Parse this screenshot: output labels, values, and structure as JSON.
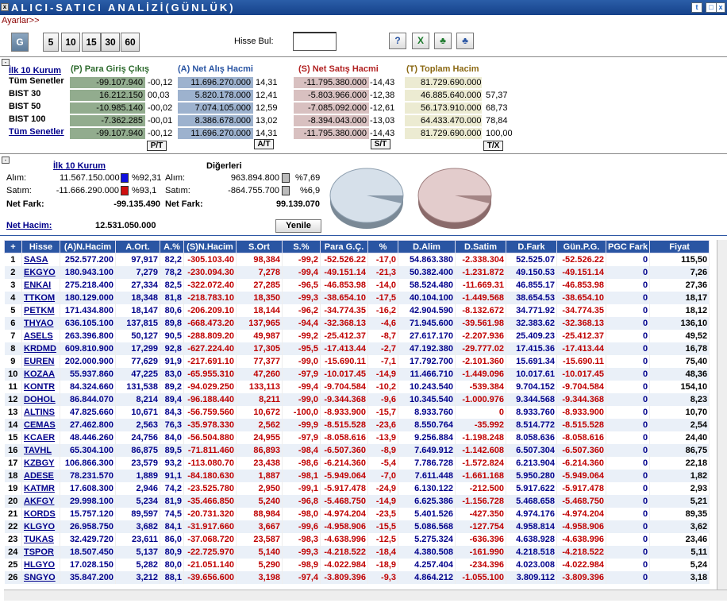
{
  "title": "ALICI-SATICI ANALİZİ(GÜNLÜK)",
  "ayarlar": "Ayarlar>>",
  "periods": [
    "G",
    "5",
    "10",
    "15",
    "30",
    "60"
  ],
  "hisse_bul_label": "Hisse Bul:",
  "top": {
    "ilk10": "İlk 10 Kurum",
    "h_p": "(P) Para Giriş Çıkış",
    "h_a": "(A) Net Alış Hacmi",
    "h_s": "(S) Net Satış Hacmi",
    "h_t": "(T) Toplam Hacim",
    "rows": [
      {
        "name": "Tüm Senetler",
        "p": "-99.107.940",
        "pp": "-00,12",
        "a": "11.696.270.000",
        "ap": "14,31",
        "s": "-11.795.380.000",
        "sp": "-14,43",
        "t": "81.729.690.000",
        "tp": ""
      },
      {
        "name": "BIST 30",
        "p": "16.212.150",
        "pp": "00,03",
        "a": "5.820.178.000",
        "ap": "12,41",
        "s": "-5.803.966.000",
        "sp": "-12,38",
        "t": "46.885.640.000",
        "tp": "57,37"
      },
      {
        "name": "BIST 50",
        "p": "-10.985.140",
        "pp": "-00,02",
        "a": "7.074.105.000",
        "ap": "12,59",
        "s": "-7.085.092.000",
        "sp": "-12,61",
        "t": "56.173.910.000",
        "tp": "68,73"
      },
      {
        "name": "BIST 100",
        "p": "-7.362.285",
        "pp": "-00,01",
        "a": "8.386.678.000",
        "ap": "13,02",
        "s": "-8.394.043.000",
        "sp": "-13,03",
        "t": "64.433.470.000",
        "tp": "78,84"
      },
      {
        "name": "Tüm Senetler",
        "p": "-99.107.940",
        "pp": "-00,12",
        "a": "11.696.270.000",
        "ap": "14,31",
        "s": "-11.795.380.000",
        "sp": "-14,43",
        "t": "81.729.690.000",
        "tp": "100,00"
      }
    ],
    "btn_p": "P/T",
    "btn_a": "A/T",
    "btn_s": "S/T",
    "btn_t": "T/X"
  },
  "mid": {
    "ilk10": "İlk 10 Kurum",
    "digerleri": "Diğerleri",
    "alim_lbl": "Alım:",
    "satim_lbl": "Satım:",
    "netfark_lbl": "Net Fark:",
    "alim": "11.567.150.000",
    "alim_p": "%92,31",
    "satim": "-11.666.290.000",
    "satim_p": "%93,1",
    "netfark": "-99.135.490",
    "d_alim": "963.894.800",
    "d_alim_p": "%7,69",
    "d_satim": "-864.755.700",
    "d_satim_p": "%6,9",
    "d_netfark": "99.139.070",
    "nethacim_lbl": "Net Hacim:",
    "nethacim": "12.531.050.000",
    "yenile": "Yenile"
  },
  "columns": [
    "+",
    "Hisse",
    "(A)N.Hacim",
    "A.Ort.",
    "A.%",
    "(S)N.Hacim",
    "S.Ort",
    "S.%",
    "Para G.Ç.",
    "%",
    "D.Alim",
    "D.Satim",
    "D.Fark",
    "Gün.P.G.",
    "PGC Fark",
    "Fiyat"
  ],
  "rows": [
    [
      "1",
      "SASA",
      "252.577.200",
      "97,917",
      "82,2",
      "-305.103.40",
      "98,384",
      "-99,2",
      "-52.526.22",
      "-17,0",
      "54.863.380",
      "-2.338.304",
      "52.525.07",
      "-52.526.22",
      "0",
      "115,50"
    ],
    [
      "2",
      "EKGYO",
      "180.943.100",
      "7,279",
      "78,2",
      "-230.094.30",
      "7,278",
      "-99,4",
      "-49.151.14",
      "-21,3",
      "50.382.400",
      "-1.231.872",
      "49.150.53",
      "-49.151.14",
      "0",
      "7,26"
    ],
    [
      "3",
      "ENKAI",
      "275.218.400",
      "27,334",
      "82,5",
      "-322.072.40",
      "27,285",
      "-96,5",
      "-46.853.98",
      "-14,0",
      "58.524.480",
      "-11.669.31",
      "46.855.17",
      "-46.853.98",
      "0",
      "27,36"
    ],
    [
      "4",
      "TTKOM",
      "180.129.000",
      "18,348",
      "81,8",
      "-218.783.10",
      "18,350",
      "-99,3",
      "-38.654.10",
      "-17,5",
      "40.104.100",
      "-1.449.568",
      "38.654.53",
      "-38.654.10",
      "0",
      "18,17"
    ],
    [
      "5",
      "PETKM",
      "171.434.800",
      "18,147",
      "80,6",
      "-206.209.10",
      "18,144",
      "-96,2",
      "-34.774.35",
      "-16,2",
      "42.904.590",
      "-8.132.672",
      "34.771.92",
      "-34.774.35",
      "0",
      "18,12"
    ],
    [
      "6",
      "THYAO",
      "636.105.100",
      "137,815",
      "89,8",
      "-668.473.20",
      "137,965",
      "-94,4",
      "-32.368.13",
      "-4,6",
      "71.945.600",
      "-39.561.98",
      "32.383.62",
      "-32.368.13",
      "0",
      "136,10"
    ],
    [
      "7",
      "ASELS",
      "263.396.800",
      "50,127",
      "90,5",
      "-288.809.20",
      "49,987",
      "-99,2",
      "-25.412.37",
      "-8,7",
      "27.617.170",
      "-2.207.936",
      "25.409.23",
      "-25.412.37",
      "0",
      "49,52"
    ],
    [
      "8",
      "KRDMD",
      "609.810.900",
      "17,299",
      "92,8",
      "-627.224.40",
      "17,305",
      "-95,5",
      "-17.413.44",
      "-2,7",
      "47.192.380",
      "-29.777.02",
      "17.415.36",
      "-17.413.44",
      "0",
      "16,78"
    ],
    [
      "9",
      "EUREN",
      "202.000.900",
      "77,629",
      "91,9",
      "-217.691.10",
      "77,377",
      "-99,0",
      "-15.690.11",
      "-7,1",
      "17.792.700",
      "-2.101.360",
      "15.691.34",
      "-15.690.11",
      "0",
      "75,40"
    ],
    [
      "10",
      "KOZAA",
      "55.937.860",
      "47,225",
      "83,0",
      "-65.955.310",
      "47,260",
      "-97,9",
      "-10.017.45",
      "-14,9",
      "11.466.710",
      "-1.449.096",
      "10.017.61",
      "-10.017.45",
      "0",
      "48,36"
    ],
    [
      "11",
      "KONTR",
      "84.324.660",
      "131,538",
      "89,2",
      "-94.029.250",
      "133,113",
      "-99,4",
      "-9.704.584",
      "-10,2",
      "10.243.540",
      "-539.384",
      "9.704.152",
      "-9.704.584",
      "0",
      "154,10"
    ],
    [
      "12",
      "DOHOL",
      "86.844.070",
      "8,214",
      "89,4",
      "-96.188.440",
      "8,211",
      "-99,0",
      "-9.344.368",
      "-9,6",
      "10.345.540",
      "-1.000.976",
      "9.344.568",
      "-9.344.368",
      "0",
      "8,23"
    ],
    [
      "13",
      "ALTINS",
      "47.825.660",
      "10,671",
      "84,3",
      "-56.759.560",
      "10,672",
      "-100,0",
      "-8.933.900",
      "-15,7",
      "8.933.760",
      "0",
      "8.933.760",
      "-8.933.900",
      "0",
      "10,70"
    ],
    [
      "14",
      "CEMAS",
      "27.462.800",
      "2,563",
      "76,3",
      "-35.978.330",
      "2,562",
      "-99,9",
      "-8.515.528",
      "-23,6",
      "8.550.764",
      "-35.992",
      "8.514.772",
      "-8.515.528",
      "0",
      "2,54"
    ],
    [
      "15",
      "KCAER",
      "48.446.260",
      "24,756",
      "84,0",
      "-56.504.880",
      "24,955",
      "-97,9",
      "-8.058.616",
      "-13,9",
      "9.256.884",
      "-1.198.248",
      "8.058.636",
      "-8.058.616",
      "0",
      "24,40"
    ],
    [
      "16",
      "TAVHL",
      "65.304.100",
      "86,875",
      "89,5",
      "-71.811.460",
      "86,893",
      "-98,4",
      "-6.507.360",
      "-8,9",
      "7.649.912",
      "-1.142.608",
      "6.507.304",
      "-6.507.360",
      "0",
      "86,75"
    ],
    [
      "17",
      "KZBGY",
      "106.866.300",
      "23,579",
      "93,2",
      "-113.080.70",
      "23,438",
      "-98,6",
      "-6.214.360",
      "-5,4",
      "7.786.728",
      "-1.572.824",
      "6.213.904",
      "-6.214.360",
      "0",
      "22,18"
    ],
    [
      "18",
      "ADESE",
      "78.231.570",
      "1,889",
      "91,1",
      "-84.180.630",
      "1,887",
      "-98,1",
      "-5.949.064",
      "-7,0",
      "7.611.448",
      "-1.661.168",
      "5.950.280",
      "-5.949.064",
      "0",
      "1,82"
    ],
    [
      "19",
      "KATMR",
      "17.608.300",
      "2,946",
      "74,2",
      "-23.525.780",
      "2,950",
      "-99,1",
      "-5.917.478",
      "-24,9",
      "6.130.122",
      "-212.500",
      "5.917.622",
      "-5.917.478",
      "0",
      "2,93"
    ],
    [
      "20",
      "AKFGY",
      "29.998.100",
      "5,234",
      "81,9",
      "-35.466.850",
      "5,240",
      "-96,8",
      "-5.468.750",
      "-14,9",
      "6.625.386",
      "-1.156.728",
      "5.468.658",
      "-5.468.750",
      "0",
      "5,21"
    ],
    [
      "21",
      "KORDS",
      "15.757.120",
      "89,597",
      "74,5",
      "-20.731.320",
      "88,984",
      "-98,0",
      "-4.974.204",
      "-23,5",
      "5.401.526",
      "-427.350",
      "4.974.176",
      "-4.974.204",
      "0",
      "89,35"
    ],
    [
      "22",
      "KLGYO",
      "26.958.750",
      "3,682",
      "84,1",
      "-31.917.660",
      "3,667",
      "-99,6",
      "-4.958.906",
      "-15,5",
      "5.086.568",
      "-127.754",
      "4.958.814",
      "-4.958.906",
      "0",
      "3,62"
    ],
    [
      "23",
      "TUKAS",
      "32.429.720",
      "23,611",
      "86,0",
      "-37.068.720",
      "23,587",
      "-98,3",
      "-4.638.996",
      "-12,5",
      "5.275.324",
      "-636.396",
      "4.638.928",
      "-4.638.996",
      "0",
      "23,46"
    ],
    [
      "24",
      "TSPOR",
      "18.507.450",
      "5,137",
      "80,9",
      "-22.725.970",
      "5,140",
      "-99,3",
      "-4.218.522",
      "-18,4",
      "4.380.508",
      "-161.990",
      "4.218.518",
      "-4.218.522",
      "0",
      "5,11"
    ],
    [
      "25",
      "HLGYO",
      "17.028.150",
      "5,282",
      "80,0",
      "-21.051.140",
      "5,290",
      "-98,9",
      "-4.022.984",
      "-18,9",
      "4.257.404",
      "-234.396",
      "4.023.008",
      "-4.022.984",
      "0",
      "5,24"
    ],
    [
      "26",
      "SNGYO",
      "35.847.200",
      "3,212",
      "88,1",
      "-39.656.600",
      "3,198",
      "-97,4",
      "-3.809.396",
      "-9,3",
      "4.864.212",
      "-1.055.100",
      "3.809.112",
      "-3.809.396",
      "0",
      "3,18"
    ]
  ],
  "colors": {
    "header_blue": "#2a55a3",
    "buy_blue": "#00008b",
    "sell_red": "#c00000"
  }
}
